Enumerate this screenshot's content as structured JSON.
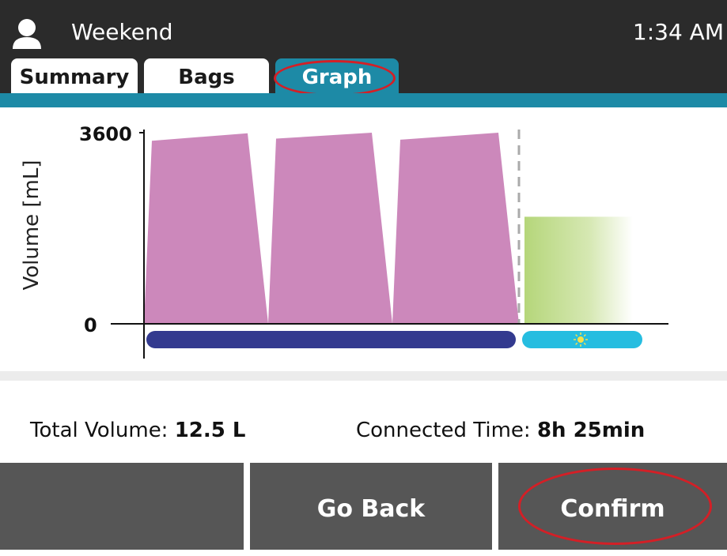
{
  "header": {
    "profile_name": "Weekend",
    "clock": "1:34 AM",
    "tabs": [
      {
        "label": "Summary",
        "active": false
      },
      {
        "label": "Bags",
        "active": false
      },
      {
        "label": "Graph",
        "active": true
      }
    ]
  },
  "colors": {
    "accent": "#1d8aa6",
    "fill_bars": "#cc88bb",
    "day_fill": "#b5d67a",
    "night_bar": "#333a8f",
    "day_bar": "#26bde0",
    "highlight_ring": "#d41f26",
    "button_bg": "#565656"
  },
  "chart_data": {
    "type": "area",
    "ylabel": "Volume [mL]",
    "yticks": [
      "0",
      "3600"
    ],
    "ylim": [
      0,
      3600
    ],
    "cycles": [
      {
        "start_volume": 3420,
        "end_volume": 3560
      },
      {
        "start_volume": 3460,
        "end_volume": 3570
      },
      {
        "start_volume": 3440,
        "end_volume": 3570
      }
    ],
    "day_dwell_volume": 2000,
    "night_icon": "moon-icon",
    "day_icon": "sun-icon"
  },
  "summary": {
    "total_volume_label": "Total Volume:",
    "total_volume_value": "12.5 L",
    "connected_time_label": "Connected Time:",
    "connected_time_value": "8h 25min"
  },
  "buttons": {
    "left_label": "",
    "go_back_label": "Go Back",
    "confirm_label": "Confirm"
  }
}
